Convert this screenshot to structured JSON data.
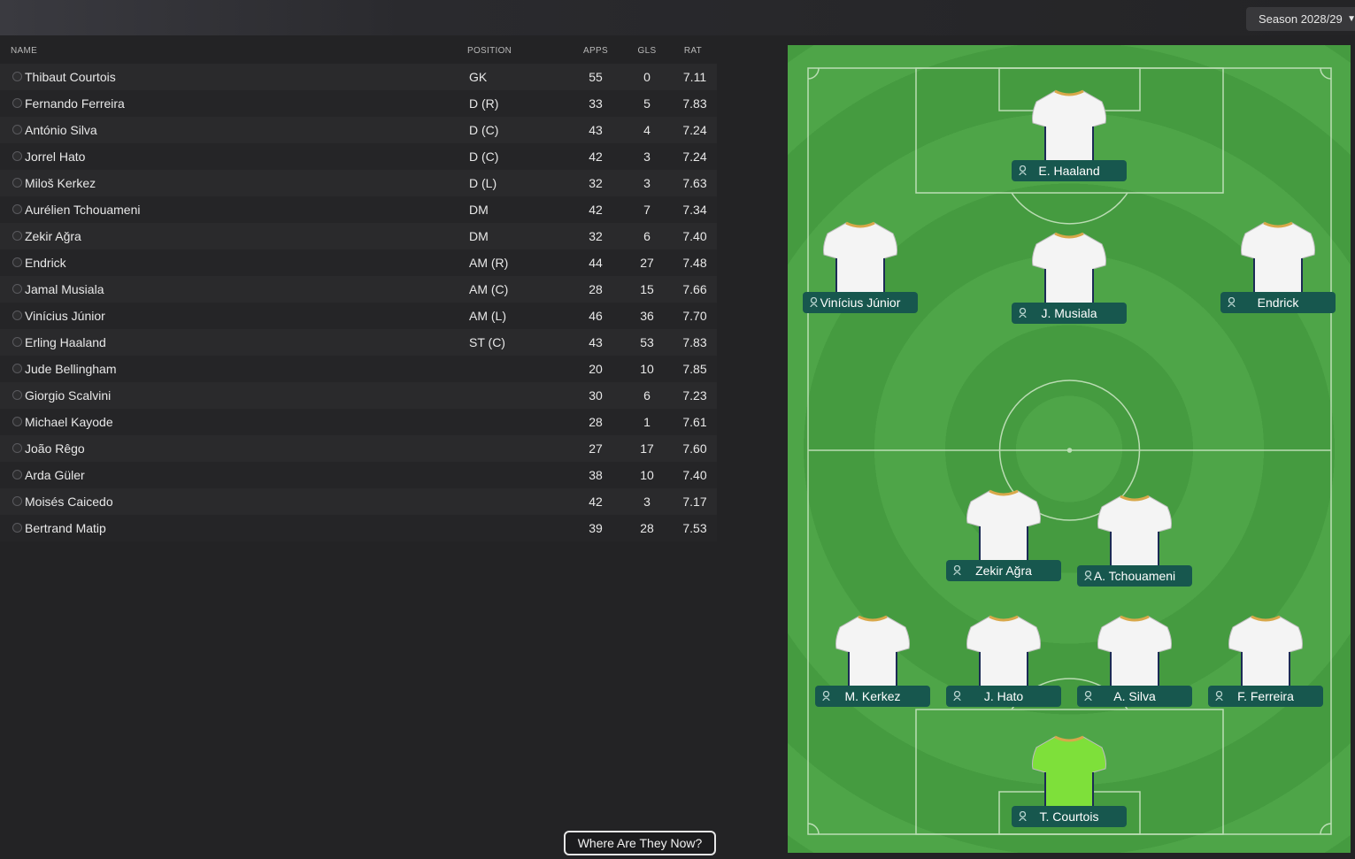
{
  "season": {
    "label": "Season 2028/29",
    "chevron_icon": "chevron-down-icon"
  },
  "columns": {
    "name": "NAME",
    "position": "POSITION",
    "apps": "APPS",
    "gls": "GLS",
    "rat": "RAT"
  },
  "players": [
    {
      "name": "Thibaut Courtois",
      "position": "GK",
      "apps": "55",
      "gls": "0",
      "rat": "7.11"
    },
    {
      "name": "Fernando Ferreira",
      "position": "D (R)",
      "apps": "33",
      "gls": "5",
      "rat": "7.83"
    },
    {
      "name": "António Silva",
      "position": "D (C)",
      "apps": "43",
      "gls": "4",
      "rat": "7.24"
    },
    {
      "name": "Jorrel Hato",
      "position": "D (C)",
      "apps": "42",
      "gls": "3",
      "rat": "7.24"
    },
    {
      "name": "Miloš Kerkez",
      "position": "D (L)",
      "apps": "32",
      "gls": "3",
      "rat": "7.63"
    },
    {
      "name": "Aurélien Tchouameni",
      "position": "DM",
      "apps": "42",
      "gls": "7",
      "rat": "7.34"
    },
    {
      "name": "Zekir Ağra",
      "position": "DM",
      "apps": "32",
      "gls": "6",
      "rat": "7.40"
    },
    {
      "name": "Endrick",
      "position": "AM (R)",
      "apps": "44",
      "gls": "27",
      "rat": "7.48"
    },
    {
      "name": "Jamal Musiala",
      "position": "AM (C)",
      "apps": "28",
      "gls": "15",
      "rat": "7.66"
    },
    {
      "name": "Vinícius Júnior",
      "position": "AM (L)",
      "apps": "46",
      "gls": "36",
      "rat": "7.70"
    },
    {
      "name": "Erling Haaland",
      "position": "ST (C)",
      "apps": "43",
      "gls": "53",
      "rat": "7.83"
    },
    {
      "name": "Jude Bellingham",
      "position": "",
      "apps": "20",
      "gls": "10",
      "rat": "7.85"
    },
    {
      "name": "Giorgio Scalvini",
      "position": "",
      "apps": "30",
      "gls": "6",
      "rat": "7.23"
    },
    {
      "name": "Michael Kayode",
      "position": "",
      "apps": "28",
      "gls": "1",
      "rat": "7.61"
    },
    {
      "name": "João Rêgo",
      "position": "",
      "apps": "27",
      "gls": "17",
      "rat": "7.60"
    },
    {
      "name": "Arda Güler",
      "position": "",
      "apps": "38",
      "gls": "10",
      "rat": "7.40"
    },
    {
      "name": "Moisés Caicedo",
      "position": "",
      "apps": "42",
      "gls": "3",
      "rat": "7.17"
    },
    {
      "name": "Bertrand Matip",
      "position": "",
      "apps": "39",
      "gls": "28",
      "rat": "7.53"
    }
  ],
  "formation": [
    {
      "label": "E. Haaland",
      "kit": "outfield"
    },
    {
      "label": "Vinícius Júnior",
      "kit": "outfield"
    },
    {
      "label": "J. Musiala",
      "kit": "outfield"
    },
    {
      "label": "Endrick",
      "kit": "outfield"
    },
    {
      "label": "Zekir Ağra",
      "kit": "outfield"
    },
    {
      "label": "A. Tchouameni",
      "kit": "outfield"
    },
    {
      "label": "M. Kerkez",
      "kit": "outfield"
    },
    {
      "label": "J. Hato",
      "kit": "outfield"
    },
    {
      "label": "A. Silva",
      "kit": "outfield"
    },
    {
      "label": "F. Ferreira",
      "kit": "outfield"
    },
    {
      "label": "T. Courtois",
      "kit": "goalkeeper"
    }
  ],
  "colors": {
    "kit_outfield": "#f4f4f4",
    "kit_trim": "#d8a84a",
    "kit_goalkeeper": "#7ee03a",
    "nameplate": "#17574e",
    "pitch": "#4ea548"
  },
  "footer": {
    "where_button": "Where Are They Now?"
  }
}
